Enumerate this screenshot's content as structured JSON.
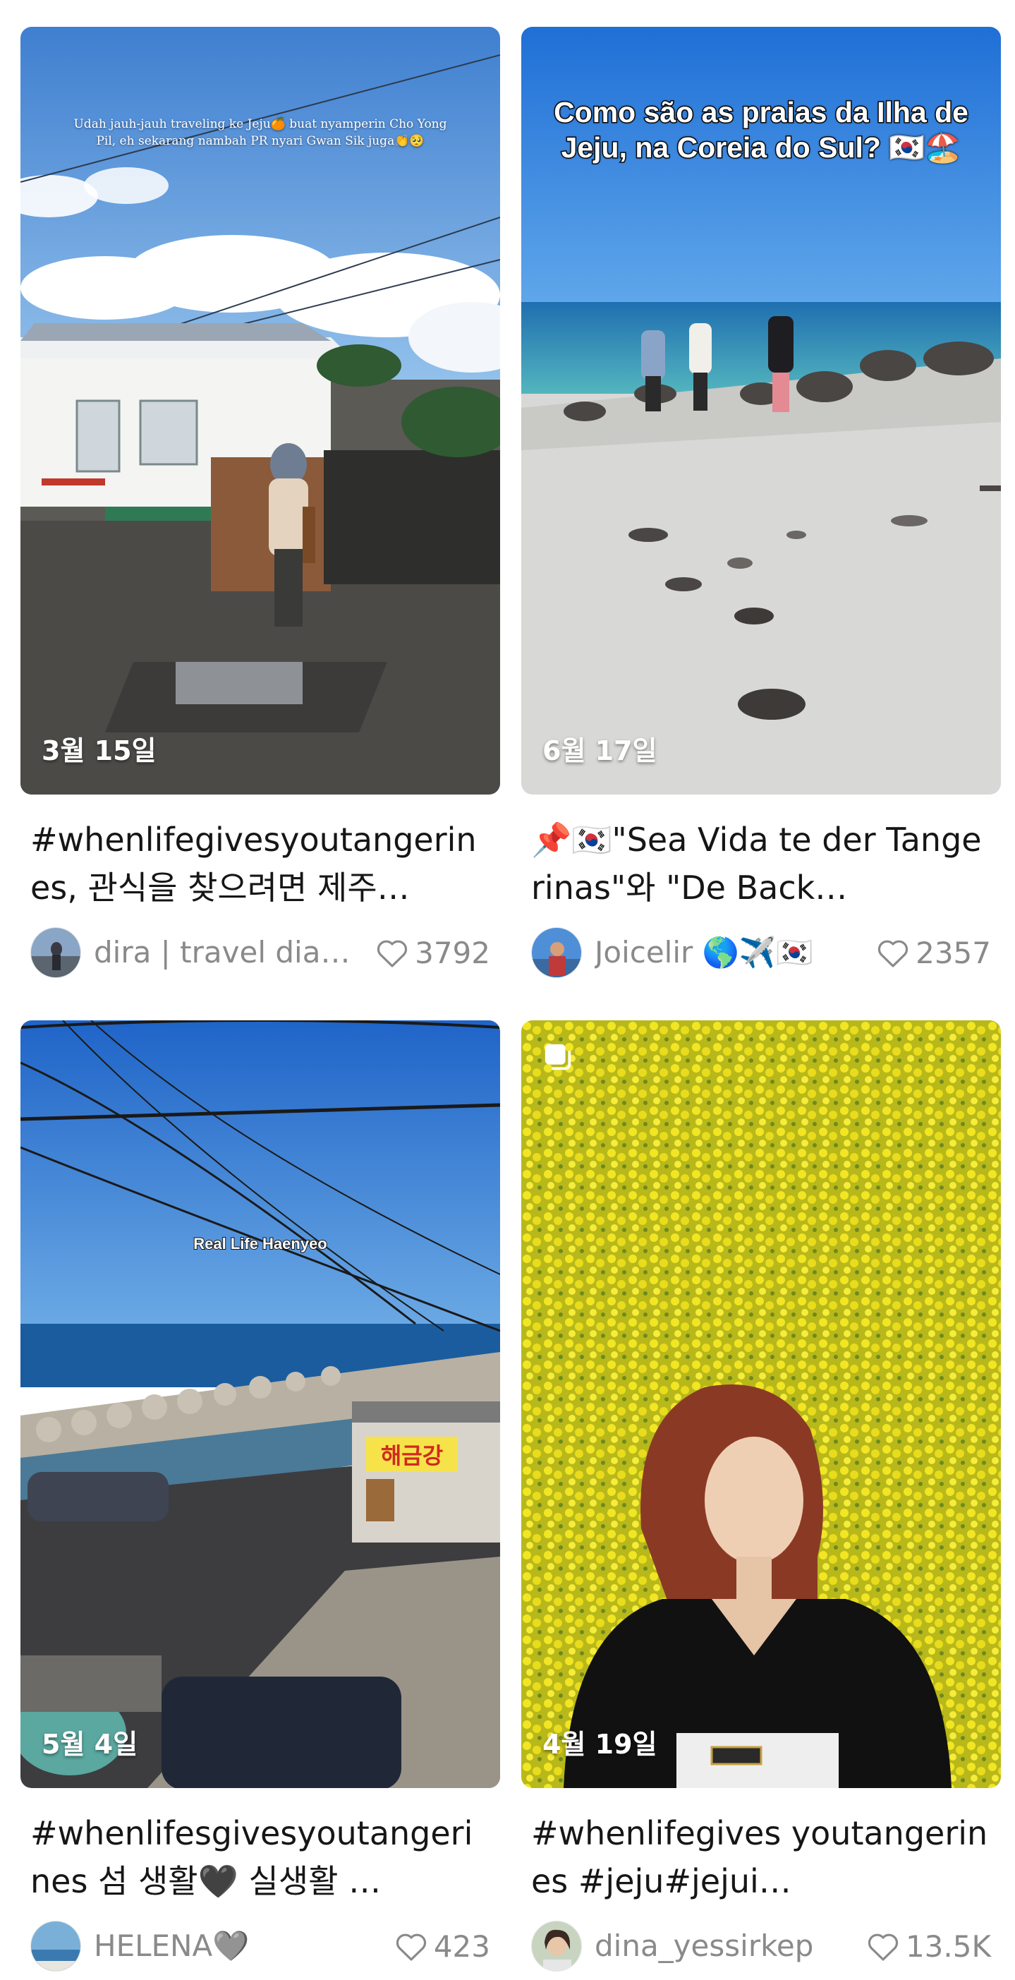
{
  "cards": [
    {
      "date": "3월 15일",
      "overlay": "Udah jauh-jauh traveling ke Jeju🍊 buat nyamperin Cho Yong Pil, eh sekarang nambah PR nyari Gwan Sik juga👏🥺",
      "title": "#whenlifegivesyoutangerines, 관식을 찾으려면 제주…",
      "author": "dira | travel dia…",
      "likes": "3792"
    },
    {
      "date": "6월 17일",
      "overlay": "Como são as praias da Ilha de Jeju, na Coreia do Sul? 🇰🇷🏖️",
      "title": "📌🇰🇷\"Sea Vida te der Tangerinas\"와 \"De Back…",
      "author": "Joicelir 🌎✈️🇰🇷",
      "likes": "2357"
    },
    {
      "date": "5월 4일",
      "overlay": "Real Life Haenyeo",
      "sign": "해금강",
      "title": "#whenlifesgivesyoutangerines 섬 생활🖤 실생활 …",
      "author": "HELENA🩶",
      "likes": "423"
    },
    {
      "date": "4월 19일",
      "title": "#whenlifegives youtangerines #jeju#jejui…",
      "author": "dina_yessirkep",
      "likes": "13.5K"
    }
  ],
  "colors": {
    "text": "#161616",
    "muted": "#8a8a8a",
    "background": "#ffffff"
  },
  "icons": {
    "like": "heart-outline-icon",
    "multi": "multi-photo-icon"
  }
}
